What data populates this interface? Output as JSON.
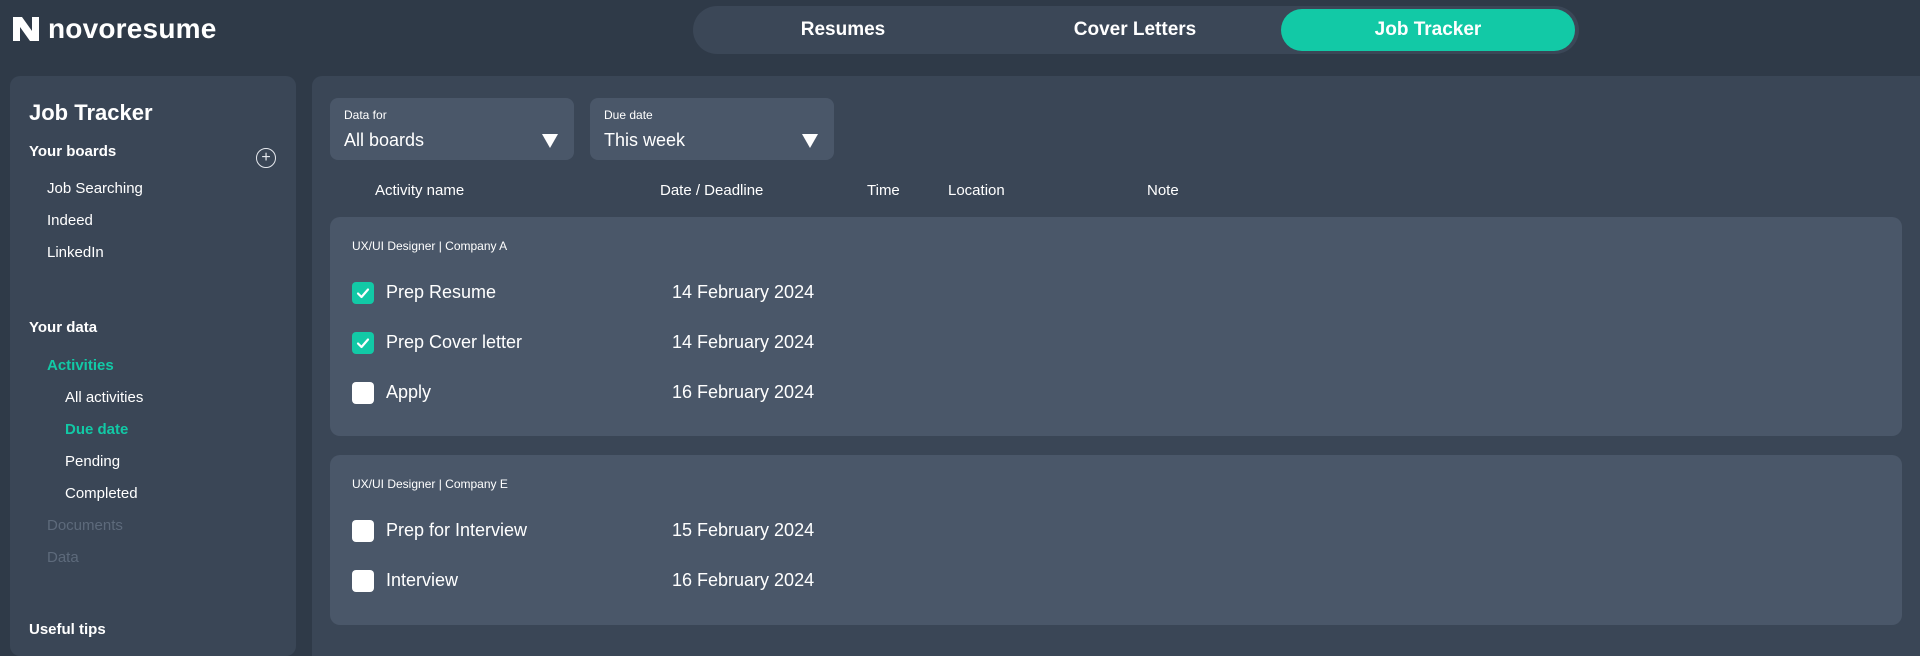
{
  "brand": {
    "name": "novoresume"
  },
  "tabs": [
    {
      "label": "Resumes"
    },
    {
      "label": "Cover Letters"
    },
    {
      "label": "Job Tracker"
    }
  ],
  "sidebar": {
    "title": "Job Tracker",
    "boards_heading": "Your boards",
    "boards": [
      "Job Searching",
      "Indeed",
      "LinkedIn"
    ],
    "data_heading": "Your data",
    "activities_label": "Activities",
    "activity_items": [
      "All activities",
      "Due date",
      "Pending",
      "Completed"
    ],
    "documents_label": "Documents",
    "data_label": "Data",
    "tips_heading": "Useful tips"
  },
  "filters": {
    "data_for": {
      "label": "Data for",
      "value": "All boards"
    },
    "due_date": {
      "label": "Due date",
      "value": "This week"
    }
  },
  "columns": [
    "Activity name",
    "Date / Deadline",
    "Time",
    "Location",
    "Note"
  ],
  "groups": [
    {
      "title": "UX/UI Designer | Company A",
      "rows": [
        {
          "name": "Prep Resume",
          "date": "14 February 2024",
          "checked": true
        },
        {
          "name": "Prep Cover letter",
          "date": "14 February 2024",
          "checked": true
        },
        {
          "name": "Apply",
          "date": "16 February 2024",
          "checked": false
        }
      ]
    },
    {
      "title": "UX/UI Designer | Company E",
      "rows": [
        {
          "name": "Prep for Interview",
          "date": "15 February 2024",
          "checked": false
        },
        {
          "name": "Interview",
          "date": "16 February 2024",
          "checked": false
        }
      ]
    }
  ],
  "colors": {
    "accent": "#12c9a6",
    "panel": "#3a4656",
    "card": "#4a5769",
    "background": "#2f3a48"
  }
}
